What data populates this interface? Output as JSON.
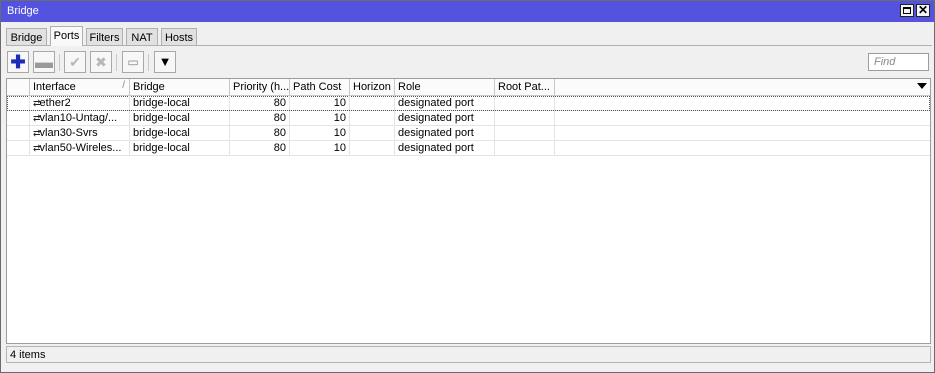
{
  "window": {
    "title": "Bridge"
  },
  "tabs": [
    {
      "label": "Bridge"
    },
    {
      "label": "Ports"
    },
    {
      "label": "Filters"
    },
    {
      "label": "NAT"
    },
    {
      "label": "Hosts"
    }
  ],
  "active_tab": "Ports",
  "toolbar": {
    "add": "add-icon",
    "remove": "remove-icon",
    "enable": "check-icon",
    "disable": "cross-icon",
    "comment": "comment-icon",
    "filter": "filter-icon"
  },
  "find": {
    "placeholder": "Find"
  },
  "table": {
    "columns": [
      "Interface",
      "Bridge",
      "Priority (h...",
      "Path Cost",
      "Horizon",
      "Role",
      "Root Pat..."
    ],
    "rows": [
      {
        "interface": "ether2",
        "bridge": "bridge-local",
        "priority": "80",
        "path_cost": "10",
        "horizon": "",
        "role": "designated port",
        "root_path": ""
      },
      {
        "interface": "vlan10-Untag/...",
        "bridge": "bridge-local",
        "priority": "80",
        "path_cost": "10",
        "horizon": "",
        "role": "designated port",
        "root_path": ""
      },
      {
        "interface": "vlan30-Svrs",
        "bridge": "bridge-local",
        "priority": "80",
        "path_cost": "10",
        "horizon": "",
        "role": "designated port",
        "root_path": ""
      },
      {
        "interface": "vlan50-Wireles...",
        "bridge": "bridge-local",
        "priority": "80",
        "path_cost": "10",
        "horizon": "",
        "role": "designated port",
        "root_path": ""
      }
    ]
  },
  "status": {
    "text": "4 items"
  },
  "colors": {
    "titlebar": "#5353e0",
    "accent_plus": "#1e2bb4"
  }
}
